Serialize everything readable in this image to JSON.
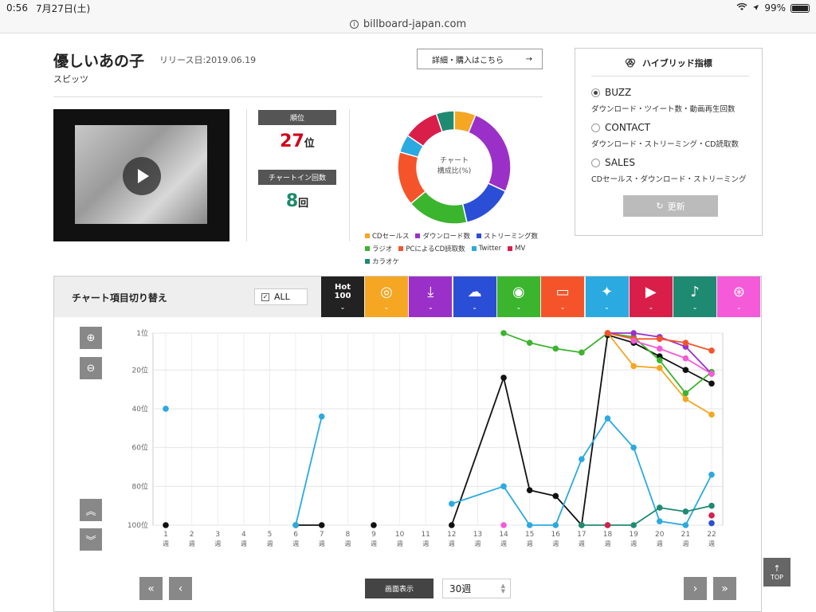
{
  "status": {
    "time": "0:56",
    "date": "7月27日(土)",
    "battery": "99%",
    "battery_level": 0.99
  },
  "url": "billboard-japan.com",
  "song": {
    "title": "優しいあの子",
    "release": "リリース日:2019.06.19",
    "artist": "スピッツ"
  },
  "detail_button": {
    "label": "詳細・購入はこちら",
    "arrow": "→"
  },
  "stats": {
    "rank_label": "順位",
    "rank_value": "27",
    "rank_unit": "位",
    "chartin_label": "チャートイン回数",
    "chartin_value": "8",
    "chartin_unit": "回"
  },
  "donut": {
    "center_line1": "チャート",
    "center_line2": "構成比(%)",
    "slices": [
      {
        "label": "CDセールス",
        "color": "#f5a623",
        "value": 6
      },
      {
        "label": "ダウンロード数",
        "color": "#9b30c8",
        "value": 25
      },
      {
        "label": "ストリーミング数",
        "color": "#2a4fd6",
        "value": 14
      },
      {
        "label": "ラジオ",
        "color": "#3bb42e",
        "value": 17
      },
      {
        "label": "PCによるCD読取数",
        "color": "#f5542a",
        "value": 15
      },
      {
        "label": "Twitter",
        "color": "#2aaae0",
        "value": 5
      },
      {
        "label": "MV",
        "color": "#d91e4a",
        "value": 10
      },
      {
        "label": "カラオケ",
        "color": "#1f8a72",
        "value": 5
      }
    ]
  },
  "hybrid": {
    "title": "ハイブリッド指標",
    "options": [
      {
        "label": "BUZZ",
        "desc": "ダウンロード・ツイート数・動画再生回数",
        "selected": true
      },
      {
        "label": "CONTACT",
        "desc": "ダウンロード・ストリーミング・CD読取数",
        "selected": false
      },
      {
        "label": "SALES",
        "desc": "CDセールス・ダウンロード・ストリーミング",
        "selected": false
      }
    ],
    "update_label": "更新"
  },
  "toolbar": {
    "title": "チャート項目切り替え",
    "all_label": "ALL",
    "hot100_line1": "Hot",
    "hot100_line2": "100",
    "categories": [
      {
        "name": "cd-sales",
        "color": "#f5a623"
      },
      {
        "name": "download",
        "color": "#9b30c8"
      },
      {
        "name": "streaming",
        "color": "#2a4fd6"
      },
      {
        "name": "radio",
        "color": "#3bb42e"
      },
      {
        "name": "pc-cd-read",
        "color": "#f5542a"
      },
      {
        "name": "twitter",
        "color": "#2aaae0"
      },
      {
        "name": "youtube",
        "color": "#d91e4a"
      },
      {
        "name": "karaoke",
        "color": "#1f8a72"
      },
      {
        "name": "hybrid",
        "color": "#f55ad8"
      }
    ]
  },
  "controls": {
    "zoom_in": "⊕",
    "zoom_out": "⊖",
    "scroll_up": "︽",
    "scroll_down": "︾"
  },
  "bottom": {
    "first": "«",
    "prev": "‹",
    "next": "›",
    "last": "»",
    "display_label": "画面表示",
    "weeks_value": "30週",
    "top_label": "TOP"
  },
  "chart_data": {
    "type": "line",
    "x": [
      1,
      2,
      3,
      4,
      5,
      6,
      7,
      8,
      9,
      10,
      11,
      12,
      13,
      14,
      15,
      16,
      17,
      18,
      19,
      20,
      21,
      22
    ],
    "x_tick_labels": [
      "1週",
      "2週",
      "3週",
      "4週",
      "5週",
      "6週",
      "7週",
      "8週",
      "9週",
      "10週",
      "11週",
      "12週",
      "13週",
      "14週",
      "15週",
      "16週",
      "17週",
      "18週",
      "19週",
      "20週",
      "21週",
      "22週"
    ],
    "y_tick_labels": [
      "1位",
      "20位",
      "40位",
      "60位",
      "80位",
      "100位"
    ],
    "y_ticks": [
      1,
      20,
      40,
      60,
      80,
      100
    ],
    "ylim": [
      1,
      100
    ],
    "y_inverted": true,
    "grid": true,
    "series": [
      {
        "name": "Hot 100",
        "color": "#111111",
        "points": [
          [
            1,
            100
          ],
          [
            6,
            100
          ],
          [
            7,
            100
          ],
          [
            9,
            100
          ],
          [
            12,
            100
          ],
          [
            14,
            24
          ],
          [
            15,
            82
          ],
          [
            16,
            85
          ],
          [
            17,
            100
          ],
          [
            18,
            2
          ],
          [
            19,
            6
          ],
          [
            20,
            13
          ],
          [
            21,
            20
          ],
          [
            22,
            27
          ]
        ]
      },
      {
        "name": "Twitter",
        "color": "#2aaae0",
        "points": [
          [
            1,
            40
          ],
          [
            6,
            100
          ],
          [
            7,
            44
          ],
          [
            12,
            89
          ],
          [
            14,
            80
          ],
          [
            15,
            100
          ],
          [
            16,
            100
          ],
          [
            17,
            66
          ],
          [
            18,
            45
          ],
          [
            19,
            60
          ],
          [
            20,
            98
          ],
          [
            21,
            100
          ],
          [
            22,
            74
          ]
        ]
      },
      {
        "name": "ラジオ",
        "color": "#3bb42e",
        "points": [
          [
            14,
            1
          ],
          [
            15,
            6
          ],
          [
            16,
            9
          ],
          [
            17,
            11
          ],
          [
            18,
            1
          ],
          [
            19,
            3
          ],
          [
            20,
            15
          ],
          [
            21,
            32
          ],
          [
            22,
            21
          ]
        ]
      },
      {
        "name": "カラオケ",
        "color": "#1f8a72",
        "points": [
          [
            17,
            100
          ],
          [
            18,
            100
          ],
          [
            19,
            100
          ],
          [
            20,
            91
          ],
          [
            21,
            93
          ],
          [
            22,
            90
          ]
        ]
      },
      {
        "name": "CDセールス",
        "color": "#f5a623",
        "points": [
          [
            18,
            1
          ],
          [
            19,
            18
          ],
          [
            20,
            19
          ],
          [
            21,
            35
          ],
          [
            22,
            43
          ]
        ]
      },
      {
        "name": "ダウンロード数",
        "color": "#9b30c8",
        "points": [
          [
            18,
            1
          ],
          [
            19,
            1
          ],
          [
            20,
            3
          ],
          [
            21,
            8
          ],
          [
            22,
            22
          ]
        ]
      },
      {
        "name": "PCによるCD読取数",
        "color": "#f5542a",
        "points": [
          [
            18,
            1
          ],
          [
            19,
            4
          ],
          [
            20,
            4
          ],
          [
            21,
            6
          ],
          [
            22,
            10
          ]
        ]
      },
      {
        "name": "ハイブリッド",
        "color": "#f55ad8",
        "points": [
          [
            14,
            100
          ],
          [
            19,
            5
          ],
          [
            20,
            9
          ],
          [
            21,
            14
          ],
          [
            22,
            22
          ]
        ]
      },
      {
        "name": "MV",
        "color": "#d91e4a",
        "points": [
          [
            18,
            100
          ],
          [
            22,
            95
          ]
        ]
      },
      {
        "name": "ストリーミング数",
        "color": "#2a4fd6",
        "points": [
          [
            22,
            99
          ]
        ]
      }
    ]
  }
}
